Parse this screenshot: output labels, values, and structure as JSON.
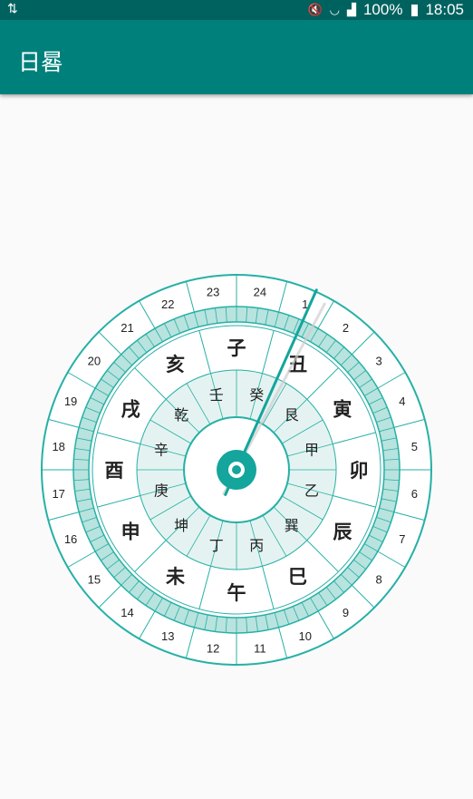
{
  "status_bar": {
    "left_icon": "data-transfer-icon",
    "battery_percent": "100%",
    "time": "18:05",
    "icons": [
      "mute-icon",
      "wifi-icon",
      "signal-icon",
      "battery-icon"
    ]
  },
  "app_bar": {
    "title": "日晷"
  },
  "dial": {
    "hour_numbers": [
      "24",
      "1",
      "2",
      "3",
      "4",
      "5",
      "6",
      "7",
      "8",
      "9",
      "10",
      "11",
      "12",
      "13",
      "14",
      "15",
      "16",
      "17",
      "18",
      "19",
      "20",
      "21",
      "22",
      "23"
    ],
    "branches": [
      "子",
      "丑",
      "寅",
      "卯",
      "辰",
      "巳",
      "午",
      "未",
      "申",
      "酉",
      "戌",
      "亥"
    ],
    "stems": [
      "癸",
      "艮",
      "甲",
      "乙",
      "巽",
      "丙",
      "丁",
      "坤",
      "庚",
      "辛",
      "乾",
      "壬"
    ],
    "hand_hour": 1.6,
    "colors": {
      "line": "#26b0a6",
      "tick_band": "#b9e3de",
      "inner_fill": "#e4f3f1",
      "hand": "#14a59c",
      "shadow": "#cfcfcf",
      "text": "#222222"
    }
  }
}
